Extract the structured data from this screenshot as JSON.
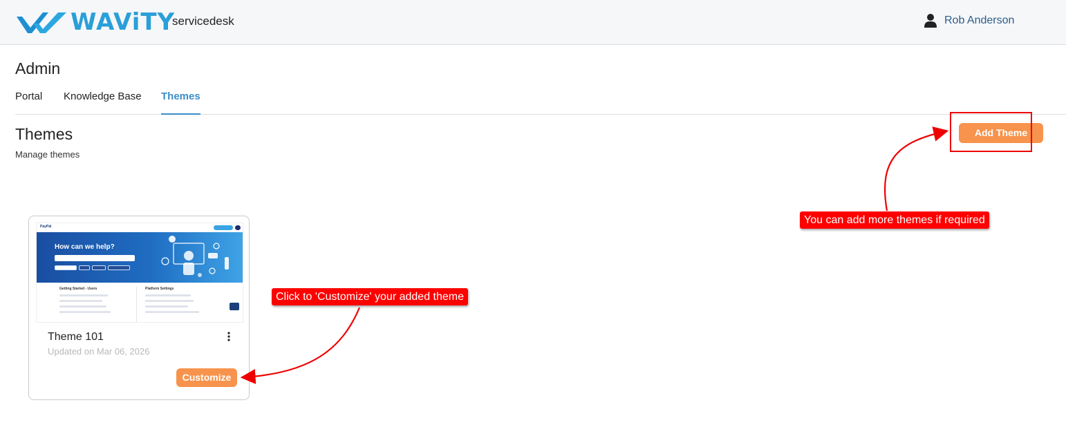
{
  "header": {
    "logo_text": "WAViTY",
    "product": "servicedesk",
    "user_name": "Rob Anderson",
    "user_icon": "user-icon"
  },
  "admin": {
    "title": "Admin",
    "tabs": [
      {
        "label": "Portal",
        "active": false
      },
      {
        "label": "Knowledge Base",
        "active": false
      },
      {
        "label": "Themes",
        "active": true
      }
    ]
  },
  "themes": {
    "title": "Themes",
    "subtitle": "Manage themes",
    "add_button": "Add Theme",
    "cards": [
      {
        "name": "Theme 101",
        "updated": "Updated on Mar 06, 2026",
        "customize_label": "Customize",
        "menu_icon": "more-vertical-icon",
        "preview": {
          "brand": "PayPal",
          "hero_title": "How can we help?",
          "col1_title": "Getting Started - Users",
          "col2_title": "Platform Settings"
        }
      }
    ]
  },
  "annotations": {
    "add_note": "You can add more themes if required",
    "customize_note": "Click to 'Customize' your added theme"
  },
  "colors": {
    "brand_blue": "#2a9fd8",
    "accent_orange": "#f7934c",
    "active_tab": "#3a8dc9",
    "annotation_red": "#ff0000"
  }
}
